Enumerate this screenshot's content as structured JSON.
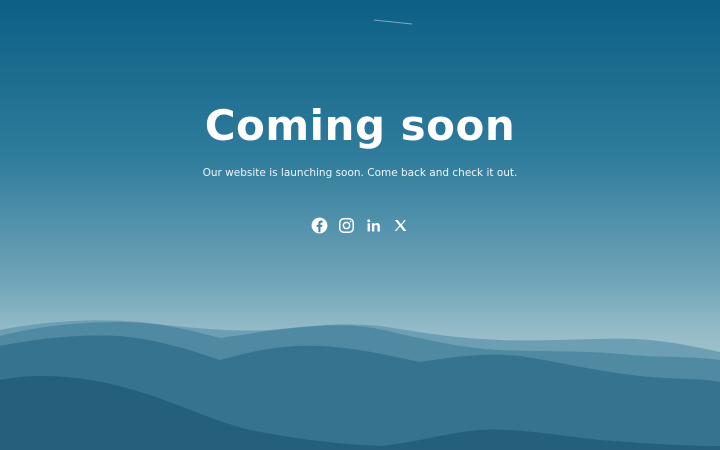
{
  "page": {
    "title": "Coming soon",
    "subtitle": "Our website is launching soon. Come back and check it out."
  },
  "social_links": [
    {
      "name": "facebook",
      "icon": "facebook-icon"
    },
    {
      "name": "instagram",
      "icon": "instagram-icon"
    },
    {
      "name": "linkedin",
      "icon": "linkedin-icon"
    },
    {
      "name": "x",
      "icon": "x-icon"
    }
  ],
  "colors": {
    "sky_top": "#0d5f85",
    "sky_bottom": "#9fc2cc",
    "text": "#ffffff",
    "mountain_far": "#5b93a8",
    "mountain_mid": "#3f7d96",
    "mountain_near": "#2c6b86",
    "mountain_front": "#1f5a76"
  }
}
